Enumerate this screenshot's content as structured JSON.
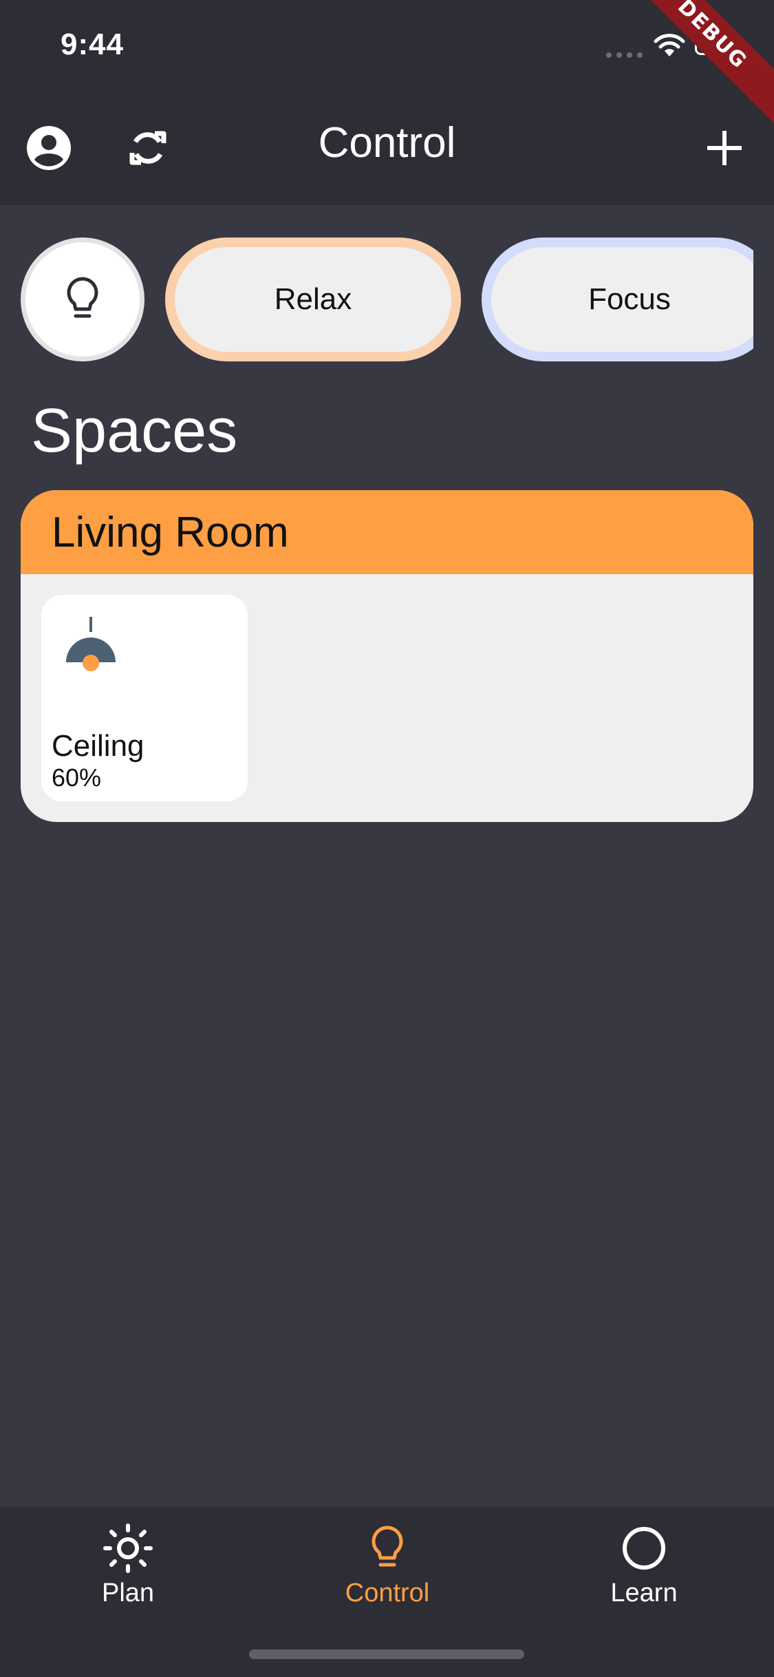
{
  "status_bar": {
    "time": "9:44",
    "signal_icon": "cellular-signal-icon",
    "wifi_icon": "wifi-icon",
    "battery_icon": "battery-icon"
  },
  "debug_banner": "DEBUG",
  "app_bar": {
    "title": "Control",
    "left_icons": [
      "account-circle-icon",
      "refresh-icon"
    ],
    "right_icon": "plus-icon"
  },
  "scenes": [
    {
      "label": "",
      "icon": "lightbulb-icon",
      "border_color": "#e3e3e6"
    },
    {
      "label": "Relax",
      "border_color": "#fbd0ad"
    },
    {
      "label": "Focus",
      "border_color": "#d3dcfb"
    }
  ],
  "spaces": {
    "heading": "Spaces",
    "rooms": [
      {
        "name": "Living Room",
        "header_color": "#fe9f44",
        "devices": [
          {
            "name": "Ceiling",
            "level": "60%",
            "icon": "pendant-lamp-icon"
          }
        ]
      }
    ]
  },
  "bottom_nav": {
    "items": [
      {
        "label": "Plan",
        "icon": "sun-icon",
        "active": false
      },
      {
        "label": "Control",
        "icon": "lightbulb-icon",
        "active": true
      },
      {
        "label": "Learn",
        "icon": "circle-icon",
        "active": false
      }
    ],
    "active_color": "#fe9f44"
  },
  "colors": {
    "background": "#383843",
    "bar_background": "#2d2d36",
    "accent": "#fe9f44",
    "card_background": "#efefef"
  }
}
